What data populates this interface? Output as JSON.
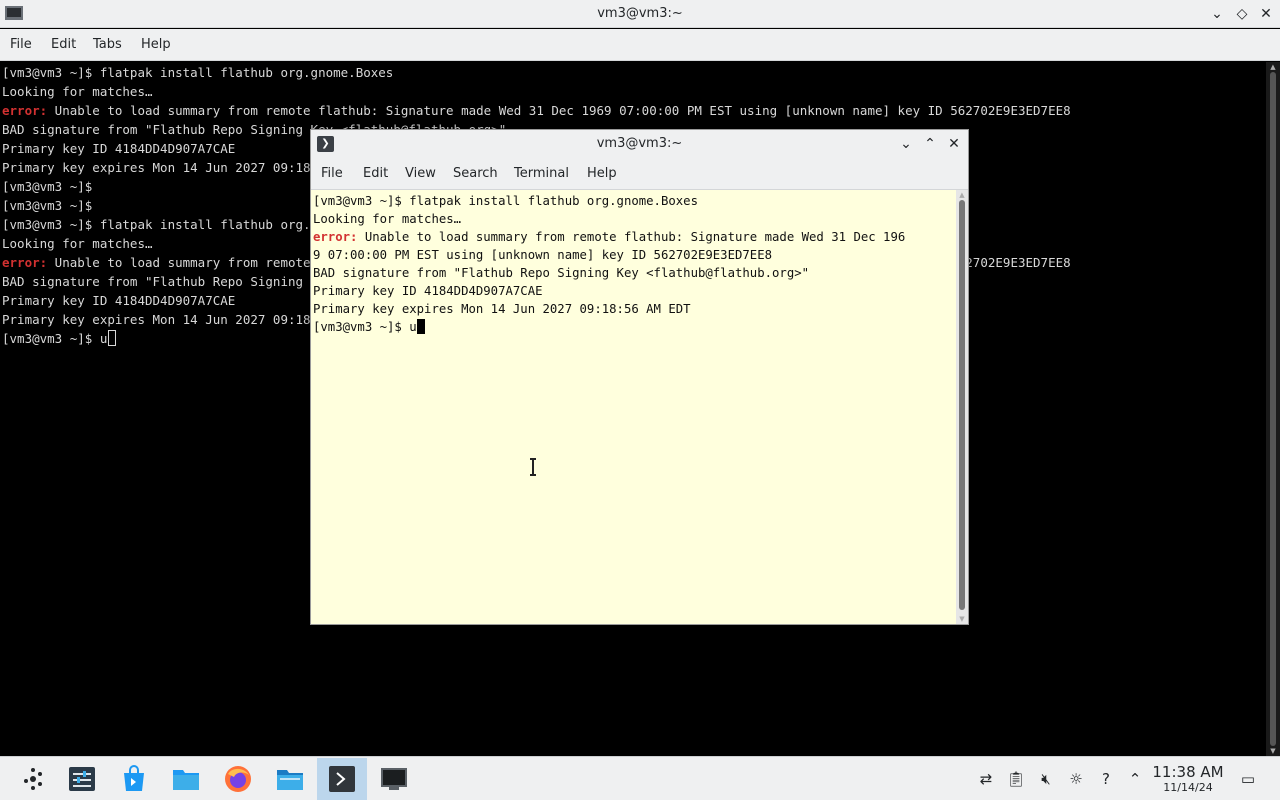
{
  "background_window": {
    "title": "vm3@vm3:~",
    "menu": [
      "File",
      "Edit",
      "Tabs",
      "Help"
    ],
    "controls": {
      "minimize": "⌄",
      "maximize": "◇",
      "close": "✕"
    },
    "lines": [
      {
        "prefix": "",
        "text": "[vm3@vm3 ~]$ flatpak install flathub org.gnome.Boxes"
      },
      {
        "prefix": "",
        "text": "Looking for matches…"
      },
      {
        "prefix": "error:",
        "text": " Unable to load summary from remote flathub: Signature made Wed 31 Dec 1969 07:00:00 PM EST using [unknown name] key ID 562702E9E3ED7EE8"
      },
      {
        "prefix": "",
        "text": "BAD signature from \"Flathub Repo Signing Key <flathub@flathub.org>\""
      },
      {
        "prefix": "",
        "text": "Primary key ID 4184DD4D907A7CAE"
      },
      {
        "prefix": "",
        "text": "Primary key expires Mon 14 Jun 2027 09:18:56 AM EDT"
      },
      {
        "prefix": "",
        "text": "[vm3@vm3 ~]$"
      },
      {
        "prefix": "",
        "text": "[vm3@vm3 ~]$"
      },
      {
        "prefix": "",
        "text": "[vm3@vm3 ~]$ flatpak install flathub org.gnome.Boxes"
      },
      {
        "prefix": "",
        "text": "Looking for matches…"
      },
      {
        "prefix": "error:",
        "text": " Unable to load summary from remote flathub: Signature made Wed 31 Dec 1969 07:00:00 PM EST using [unknown name] key ID 562702E9E3ED7EE8"
      },
      {
        "prefix": "",
        "text": "BAD signature from \"Flathub Repo Signing Key <flathub@flathub.org>\""
      },
      {
        "prefix": "",
        "text": "Primary key ID 4184DD4D907A7CAE"
      },
      {
        "prefix": "",
        "text": "Primary key expires Mon 14 Jun 2027 09:18:56 AM EDT"
      },
      {
        "prefix": "",
        "text": "[vm3@vm3 ~]$ u"
      }
    ]
  },
  "foreground_window": {
    "title": "vm3@vm3:~",
    "icon_glyph": "❯",
    "menu": [
      "File",
      "Edit",
      "View",
      "Search",
      "Terminal",
      "Help"
    ],
    "controls": {
      "minimize": "⌄",
      "maximize": "⌃",
      "close": "✕"
    },
    "lines": [
      {
        "prefix": "",
        "text": "[vm3@vm3 ~]$ flatpak install flathub org.gnome.Boxes"
      },
      {
        "prefix": "",
        "text": "Looking for matches…"
      },
      {
        "prefix": "error:",
        "text": " Unable to load summary from remote flathub: Signature made Wed 31 Dec 196"
      },
      {
        "prefix": "",
        "text": "9 07:00:00 PM EST using [unknown name] key ID 562702E9E3ED7EE8"
      },
      {
        "prefix": "",
        "text": "BAD signature from \"Flathub Repo Signing Key <flathub@flathub.org>\""
      },
      {
        "prefix": "",
        "text": "Primary key ID 4184DD4D907A7CAE"
      },
      {
        "prefix": "",
        "text": "Primary key expires Mon 14 Jun 2027 09:18:56 AM EDT"
      },
      {
        "prefix": "",
        "text": "[vm3@vm3 ~]$ u"
      }
    ]
  },
  "taskbar": {
    "apps": [
      {
        "name": "app-launcher-icon",
        "active": false
      },
      {
        "name": "system-settings-icon",
        "active": false
      },
      {
        "name": "discover-store-icon",
        "active": false
      },
      {
        "name": "file-manager-icon",
        "active": false
      },
      {
        "name": "firefox-icon",
        "active": false
      },
      {
        "name": "dolphin-icon",
        "active": false
      },
      {
        "name": "terminal-icon",
        "active": true
      },
      {
        "name": "konsole-icon",
        "active": false
      }
    ],
    "tray": [
      "network-icon",
      "clipboard-icon",
      "volume-muted-icon",
      "brightness-icon",
      "help-icon",
      "tray-expand-icon"
    ],
    "clock": {
      "time": "11:38 AM",
      "date": "11/14/24"
    }
  },
  "colors": {
    "error": "#d23131",
    "fg_terminal_bg": "#ffffdd",
    "active_task": "#bcd6ec"
  }
}
